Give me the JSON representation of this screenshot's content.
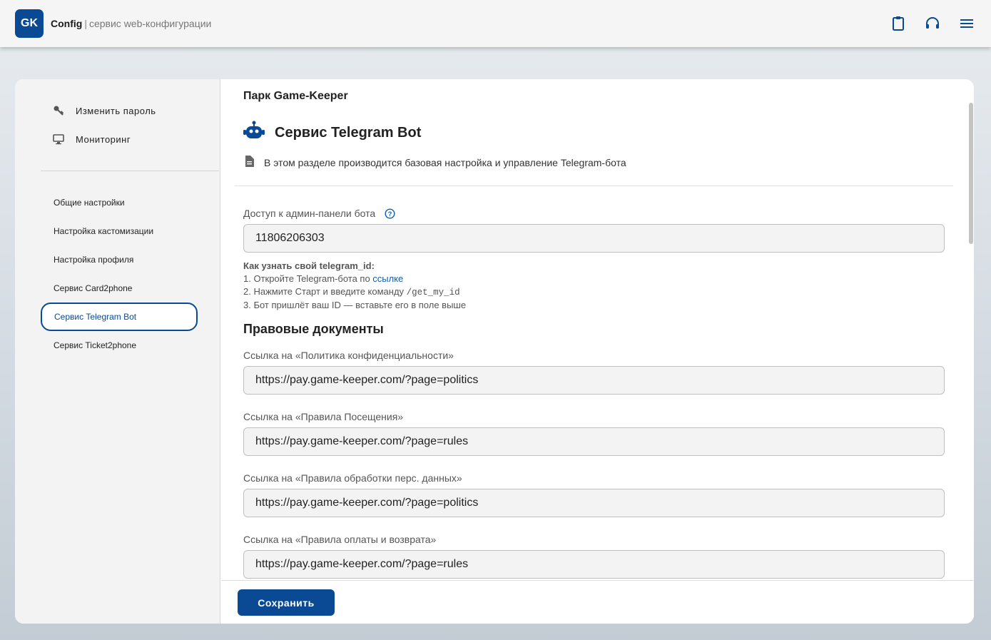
{
  "header": {
    "logo_text": "GK",
    "app_name": "Config",
    "separator": "|",
    "subtitle": "сервис web-конфигурации",
    "icons": [
      "clipboard-icon",
      "headset-icon",
      "menu-icon"
    ],
    "accent_color": "#0a4a94"
  },
  "sidebar": {
    "top_items": [
      {
        "label": "Изменить пароль",
        "icon": "key-icon"
      },
      {
        "label": "Мониторинг",
        "icon": "monitor-icon"
      }
    ],
    "links": [
      {
        "label": "Общие настройки"
      },
      {
        "label": "Настройка кастомизации"
      },
      {
        "label": "Настройка профиля"
      },
      {
        "label": "Сервис Card2phone"
      },
      {
        "label": "Сервис Telegram Bot",
        "active": true
      },
      {
        "label": "Сервис Ticket2phone"
      }
    ]
  },
  "main": {
    "park_name": "Парк Game-Keeper",
    "section_title": "Сервис Telegram Bot",
    "section_desc": "В этом разделе производится базовая настройка и управление Telegram-бота",
    "admin_access": {
      "label": "Доступ к админ-панели бота",
      "value": "11806206303"
    },
    "help": {
      "title": "Как узнать свой telegram_id:",
      "step1_prefix": "1. Откройте Telegram-бота по ",
      "step1_link": "ссылке",
      "step2_prefix": "2. Нажмите Старт и введите команду ",
      "step2_code": "/get_my_id",
      "step3": "3. Бот пришлёт ваш ID — вставьте его в поле выше"
    },
    "legal_title": "Правовые документы",
    "legal_fields": [
      {
        "label": "Ссылка на «Политика конфиденциальности»",
        "value": "https://pay.game-keeper.com/?page=politics"
      },
      {
        "label": "Ссылка на «Правила Посещения»",
        "value": "https://pay.game-keeper.com/?page=rules"
      },
      {
        "label": "Ссылка на «Правила обработки перс. данных»",
        "value": "https://pay.game-keeper.com/?page=politics"
      },
      {
        "label": "Ссылка на «Правила оплаты и возврата»",
        "value": "https://pay.game-keeper.com/?page=rules"
      }
    ]
  },
  "footer": {
    "save_label": "Сохранить"
  }
}
